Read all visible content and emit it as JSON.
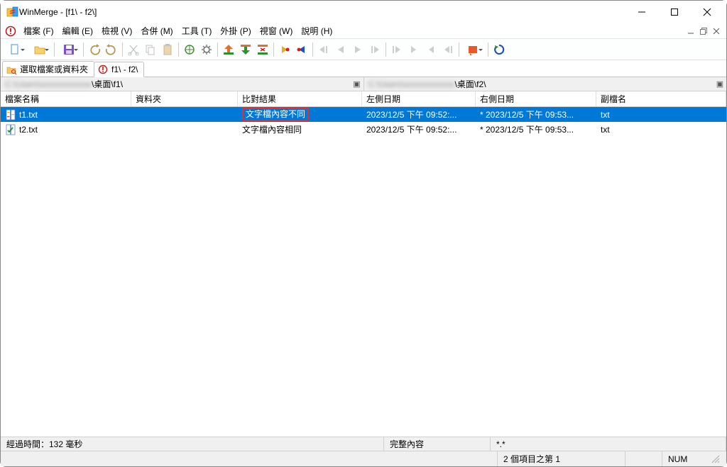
{
  "titlebar": {
    "title": "WinMerge - [f1\\ - f2\\]"
  },
  "menus": {
    "file": "檔案 (F)",
    "edit": "編輯 (E)",
    "view": "檢視 (V)",
    "merge": "合併 (M)",
    "tools": "工具 (T)",
    "plugins": "外掛 (P)",
    "window": "視窗 (W)",
    "help": "說明 (H)"
  },
  "tabs": {
    "select": "選取檔案或資料夾",
    "compare": "f1\\ - f2\\"
  },
  "paths": {
    "left_suffix": "\\桌面\\f1\\",
    "right_suffix": "\\桌面\\f2\\"
  },
  "columns": {
    "name": "檔案名稱",
    "folder": "資料夾",
    "result": "比對結果",
    "ldate": "左側日期",
    "rdate": "右側日期",
    "ext": "副檔名"
  },
  "rows": [
    {
      "name": "t1.txt",
      "folder": "",
      "result": "文字檔內容不同",
      "ldate": "2023/12/5 下午 09:52:...",
      "rdate": "* 2023/12/5 下午 09:53...",
      "ext": "txt",
      "selected": true,
      "highlight_result": true,
      "icon": "diff"
    },
    {
      "name": "t2.txt",
      "folder": "",
      "result": "文字檔內容相同",
      "ldate": "2023/12/5 下午 09:52:...",
      "rdate": "* 2023/12/5 下午 09:53...",
      "ext": "txt",
      "selected": false,
      "highlight_result": false,
      "icon": "same"
    }
  ],
  "status1": {
    "elapsed": "經過時間：132 毫秒",
    "content": "完整內容",
    "filter": "*.*"
  },
  "status2": {
    "count": "2 個項目之第 1",
    "num": "NUM"
  }
}
